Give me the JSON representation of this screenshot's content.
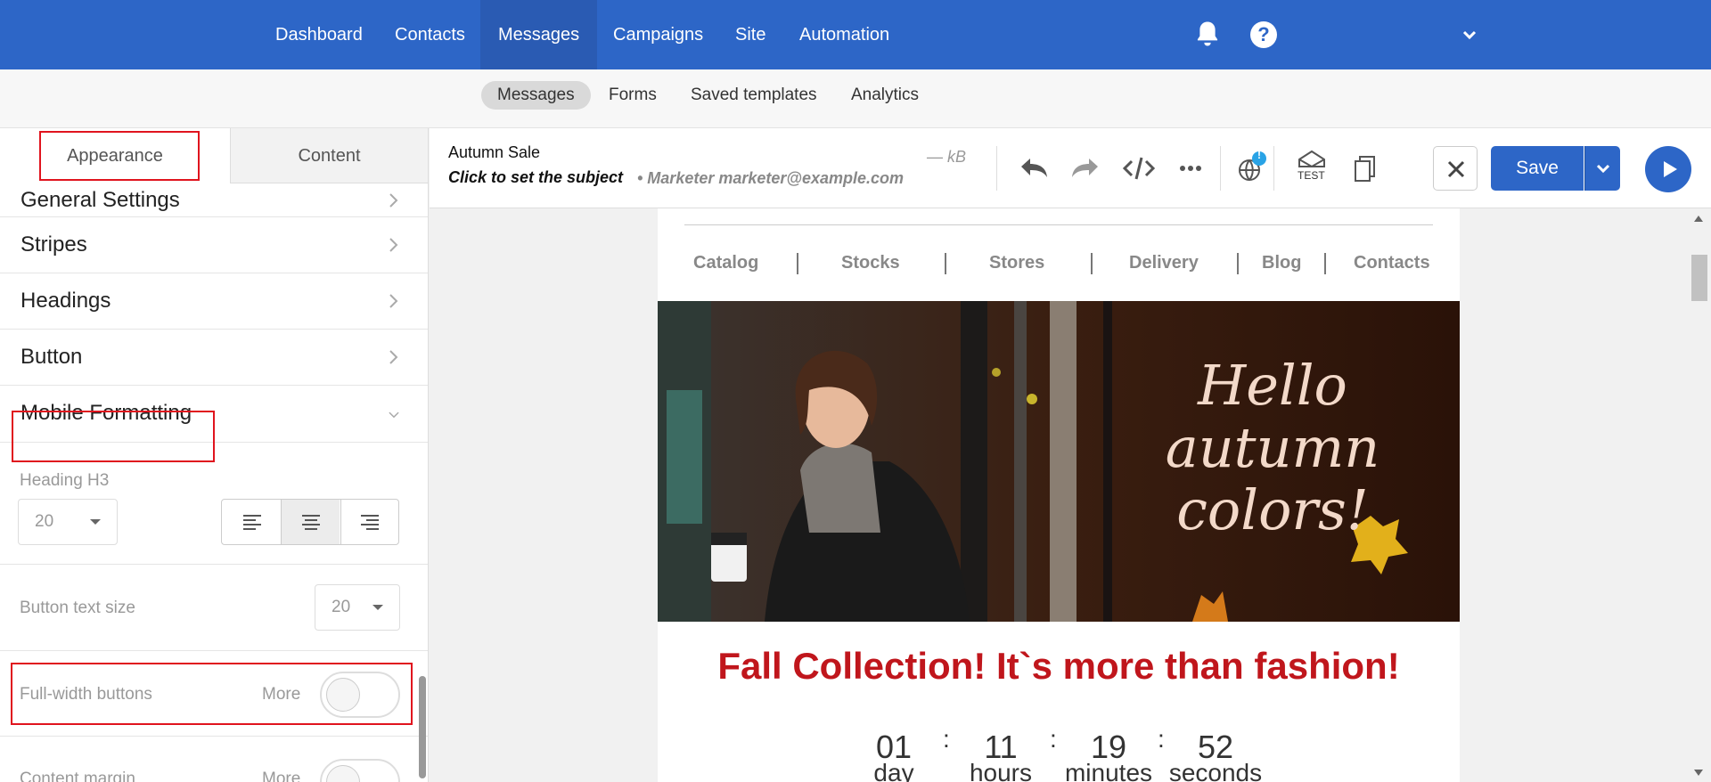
{
  "topnav": {
    "items": [
      {
        "label": "Dashboard"
      },
      {
        "label": "Contacts"
      },
      {
        "label": "Messages"
      },
      {
        "label": "Campaigns"
      },
      {
        "label": "Site"
      },
      {
        "label": "Automation"
      }
    ],
    "active_index": 2,
    "help_label": "?",
    "icons": [
      "bell-icon",
      "help-icon",
      "chevron-down-icon"
    ]
  },
  "subnav": {
    "items": [
      {
        "label": "Messages"
      },
      {
        "label": "Forms"
      },
      {
        "label": "Saved templates"
      },
      {
        "label": "Analytics"
      }
    ],
    "active_index": 0
  },
  "left_panel": {
    "tabs": [
      {
        "label": "Appearance"
      },
      {
        "label": "Content"
      }
    ],
    "active_tab": 0,
    "sections": [
      {
        "label": "General Settings"
      },
      {
        "label": "Stripes"
      },
      {
        "label": "Headings"
      },
      {
        "label": "Button"
      },
      {
        "label": "Mobile Formatting"
      }
    ],
    "mobile": {
      "heading_h3_label": "Heading H3",
      "heading_h3_size": "20",
      "align_selected": "center",
      "button_text_size_label": "Button text size",
      "button_text_size": "20",
      "full_width_label": "Full-width buttons",
      "full_width_more": "More",
      "full_width_on": false,
      "content_margin_label": "Content margin",
      "content_margin_more": "More"
    }
  },
  "editor": {
    "title": "Autumn Sale",
    "subject_placeholder": "Click to set the subject",
    "sender": "• Marketer marketer@example.com",
    "size": "— kB",
    "test_label": "TEST",
    "save_label": "Save",
    "badge": "!"
  },
  "email": {
    "menu": [
      "Catalog",
      "Stocks",
      "Stores",
      "Delivery",
      "Blog",
      "Contacts"
    ],
    "hero_text": [
      "Hello",
      "autumn",
      "colors!"
    ],
    "headline": "Fall Collection! It`s more than fashion!",
    "countdown": [
      {
        "value": "01",
        "label": "day"
      },
      {
        "value": "11",
        "label": "hours"
      },
      {
        "value": "19",
        "label": "minutes"
      },
      {
        "value": "52",
        "label": "seconds"
      }
    ],
    "colon": ":"
  },
  "colors": {
    "brand": "#2d66c7",
    "headline": "#c0161c",
    "highlight_box": "#e0141e"
  }
}
